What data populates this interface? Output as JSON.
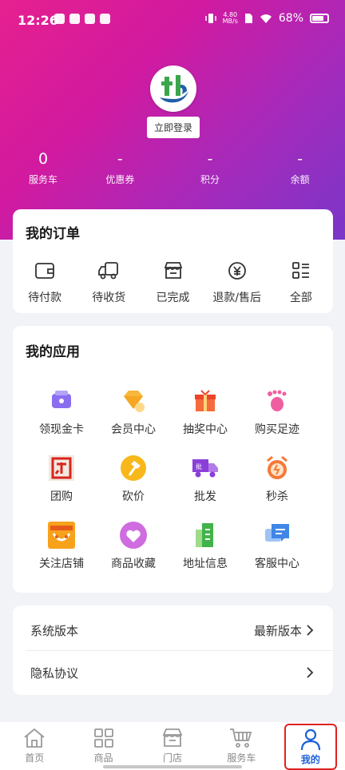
{
  "status_bar": {
    "time": "12:26",
    "speed": "4.80\nMB/s",
    "battery": "68%"
  },
  "profile": {
    "login_label": "立即登录"
  },
  "stats": [
    {
      "value": "0",
      "label": "服务车"
    },
    {
      "value": "-",
      "label": "优惠券"
    },
    {
      "value": "-",
      "label": "积分"
    },
    {
      "value": "-",
      "label": "余额"
    }
  ],
  "orders": {
    "title": "我的订单",
    "items": [
      {
        "label": "待付款",
        "icon": "wallet-icon"
      },
      {
        "label": "待收货",
        "icon": "truck-icon"
      },
      {
        "label": "已完成",
        "icon": "store-icon"
      },
      {
        "label": "退款/售后",
        "icon": "refund-icon"
      },
      {
        "label": "全部",
        "icon": "list-icon"
      }
    ]
  },
  "apps": {
    "title": "我的应用",
    "items": [
      {
        "label": "领现金卡",
        "icon": "cash-card-icon"
      },
      {
        "label": "会员中心",
        "icon": "member-diamond-icon"
      },
      {
        "label": "抽奖中心",
        "icon": "gift-box-icon"
      },
      {
        "label": "购买足迹",
        "icon": "footprint-icon"
      },
      {
        "label": "团购",
        "icon": "group-buy-icon"
      },
      {
        "label": "砍价",
        "icon": "axe-icon"
      },
      {
        "label": "批发",
        "icon": "wholesale-truck-icon"
      },
      {
        "label": "秒杀",
        "icon": "alarm-clock-icon"
      },
      {
        "label": "关注店铺",
        "icon": "follow-store-icon"
      },
      {
        "label": "商品收藏",
        "icon": "heart-icon"
      },
      {
        "label": "地址信息",
        "icon": "address-icon"
      },
      {
        "label": "客服中心",
        "icon": "chat-icon"
      }
    ]
  },
  "settings": {
    "version_label": "系统版本",
    "version_value": "最新版本",
    "privacy_label": "隐私协议"
  },
  "tabbar": [
    {
      "label": "首页",
      "icon": "home-icon"
    },
    {
      "label": "商品",
      "icon": "grid-icon"
    },
    {
      "label": "门店",
      "icon": "shop-icon"
    },
    {
      "label": "服务车",
      "icon": "cart-icon"
    },
    {
      "label": "我的",
      "icon": "user-icon",
      "active": true
    }
  ],
  "colors": {
    "accent": "#1b5fd6",
    "hero_start": "#e6208f",
    "hero_end": "#7a36c8",
    "highlight": "#e0221f"
  }
}
